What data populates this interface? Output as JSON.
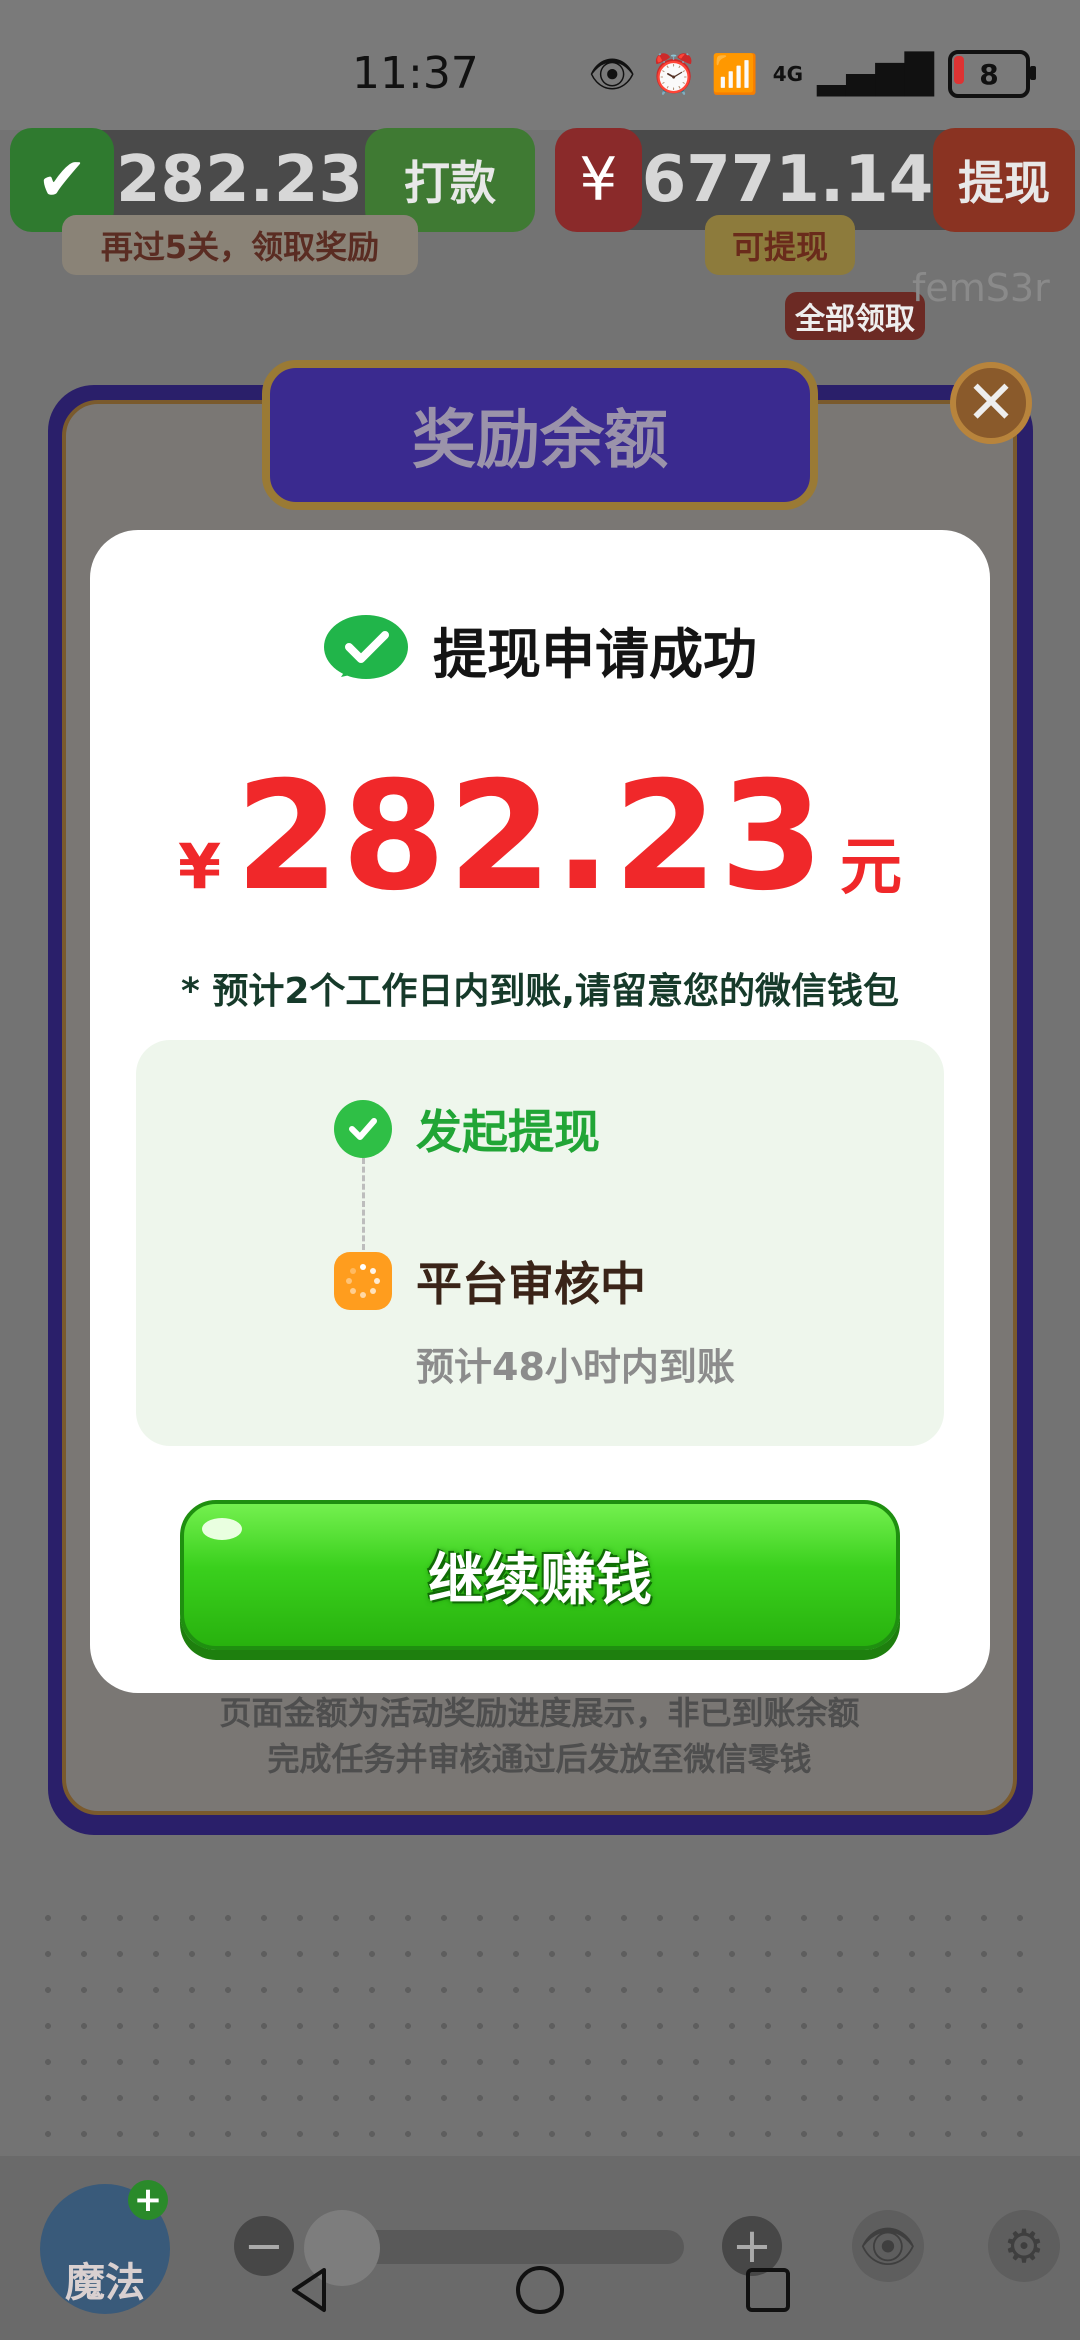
{
  "status_bar": {
    "time": "11:37",
    "network": "4G",
    "battery": "8"
  },
  "header": {
    "wallet_amount": "282.23",
    "wallet_button": "打款",
    "wallet_hint": "再过5关，领取奖励",
    "redpack_amount": "6771.14",
    "redpack_button": "提现",
    "redpack_hint": "可提现",
    "claim_all": "全部领取",
    "code_text": "femS3r"
  },
  "frame": {
    "title": "奖励余额",
    "footer_line1": "页面金额为活动奖励进度展示，非已到账余额",
    "footer_line2": "完成任务并审核通过后发放至微信零钱"
  },
  "modal": {
    "title": "提现申请成功",
    "currency_symbol": "¥",
    "amount": "282.23",
    "unit": "元",
    "notice": "* 预计2个工作日内到账,请留意您的微信钱包",
    "steps": [
      {
        "label": "发起提现"
      },
      {
        "label": "平台审核中",
        "sub": "预计48小时内到账"
      }
    ],
    "continue_button": "继续赚钱"
  },
  "toolbar": {
    "magic_label": "魔法"
  },
  "colors": {
    "amount_red": "#f0282a",
    "success_green": "#2fbf46",
    "pending_orange": "#ff9d1e",
    "button_green": "#3ad01d"
  }
}
